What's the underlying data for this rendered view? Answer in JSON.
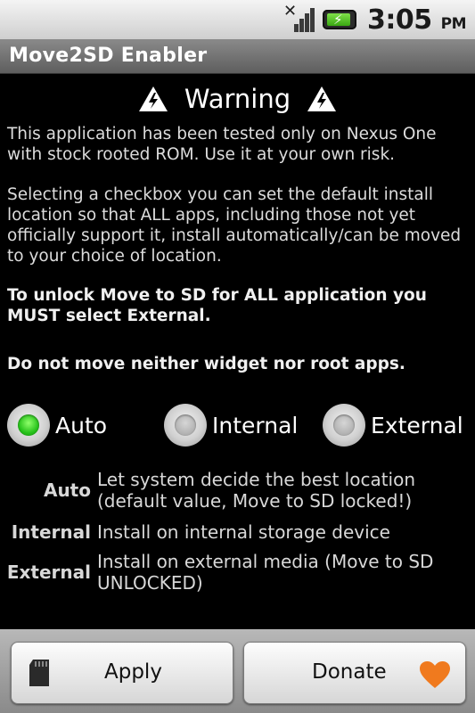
{
  "status_bar": {
    "time": "3:05",
    "ampm": "PM",
    "icons": [
      "signal-no-service-icon",
      "battery-charging-icon"
    ]
  },
  "app": {
    "title": "Move2SD Enabler"
  },
  "warning": {
    "title": "Warning",
    "icon": "warning-icon"
  },
  "paragraphs": {
    "p1": "This application has been tested only on Nexus One with stock rooted ROM. Use it at your own risk.",
    "p2": "Selecting a checkbox you can set the default install location so that ALL apps, including those not yet officially support it, install automatically/can be moved to your choice of location.",
    "p3": "To unlock Move to SD for ALL application you MUST select External.",
    "p4": "Do not move neither widget nor root apps."
  },
  "options": {
    "auto": "Auto",
    "internal": "Internal",
    "external": "External",
    "selected": "Auto"
  },
  "descriptions": {
    "auto_key": "Auto",
    "auto_val": "Let system decide the best location (default value, Move to SD locked!)",
    "internal_key": "Internal",
    "internal_val": "Install on internal storage device",
    "external_key": "External",
    "external_val": "Install on external media (Move to SD UNLOCKED)"
  },
  "buttons": {
    "apply": "Apply",
    "donate": "Donate",
    "apply_icon": "sd-card-icon",
    "donate_icon": "heart-icon"
  },
  "colors": {
    "selected_radio": "#26c21a",
    "heart": "#f07a1e"
  }
}
